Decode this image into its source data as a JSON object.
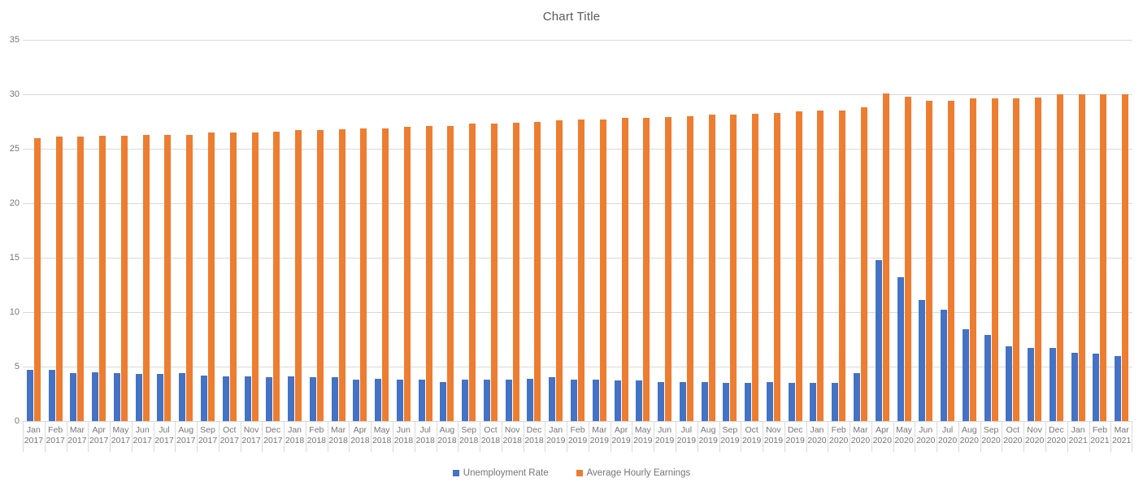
{
  "chart_data": {
    "type": "bar",
    "title": "Chart Title",
    "xlabel": "",
    "ylabel": "",
    "ylim": [
      0,
      35
    ],
    "yticks": [
      0,
      5,
      10,
      15,
      20,
      25,
      30,
      35
    ],
    "grid": true,
    "legend_position": "bottom",
    "colors": {
      "unemployment_rate": "#4472C4",
      "average_hourly_earnings": "#ED7D31"
    },
    "categories": [
      "Jan 2017",
      "Feb 2017",
      "Mar 2017",
      "Apr 2017",
      "May 2017",
      "Jun 2017",
      "Jul 2017",
      "Aug 2017",
      "Sep 2017",
      "Oct 2017",
      "Nov 2017",
      "Dec 2017",
      "Jan 2018",
      "Feb 2018",
      "Mar 2018",
      "Apr 2018",
      "May 2018",
      "Jun 2018",
      "Jul 2018",
      "Aug 2018",
      "Sep 2018",
      "Oct 2018",
      "Nov 2018",
      "Dec 2018",
      "Jan 2019",
      "Feb 2019",
      "Mar 2019",
      "Apr 2019",
      "May 2019",
      "Jun 2019",
      "Jul 2019",
      "Aug 2019",
      "Sep 2019",
      "Oct 2019",
      "Nov 2019",
      "Dec 2019",
      "Jan 2020",
      "Feb 2020",
      "Mar 2020",
      "Apr 2020",
      "May 2020",
      "Jun 2020",
      "Jul 2020",
      "Aug 2020",
      "Sep 2020",
      "Oct 2020",
      "Nov 2020",
      "Dec 2020",
      "Jan 2021",
      "Feb 2021",
      "Mar 2021"
    ],
    "category_months": [
      "Jan",
      "Feb",
      "Mar",
      "Apr",
      "May",
      "Jun",
      "Jul",
      "Aug",
      "Sep",
      "Oct",
      "Nov",
      "Dec",
      "Jan",
      "Feb",
      "Mar",
      "Apr",
      "May",
      "Jun",
      "Jul",
      "Aug",
      "Sep",
      "Oct",
      "Nov",
      "Dec",
      "Jan",
      "Feb",
      "Mar",
      "Apr",
      "May",
      "Jun",
      "Jul",
      "Aug",
      "Sep",
      "Oct",
      "Nov",
      "Dec",
      "Jan",
      "Feb",
      "Mar",
      "Apr",
      "May",
      "Jun",
      "Jul",
      "Aug",
      "Sep",
      "Oct",
      "Nov",
      "Dec",
      "Jan",
      "Feb",
      "Mar"
    ],
    "category_years": [
      "2017",
      "2017",
      "2017",
      "2017",
      "2017",
      "2017",
      "2017",
      "2017",
      "2017",
      "2017",
      "2017",
      "2017",
      "2018",
      "2018",
      "2018",
      "2018",
      "2018",
      "2018",
      "2018",
      "2018",
      "2018",
      "2018",
      "2018",
      "2018",
      "2019",
      "2019",
      "2019",
      "2019",
      "2019",
      "2019",
      "2019",
      "2019",
      "2019",
      "2019",
      "2019",
      "2019",
      "2020",
      "2020",
      "2020",
      "2020",
      "2020",
      "2020",
      "2020",
      "2020",
      "2020",
      "2020",
      "2020",
      "2020",
      "2021",
      "2021",
      "2021"
    ],
    "series": [
      {
        "name": "Unemployment Rate",
        "color": "#4472C4",
        "values": [
          4.7,
          4.7,
          4.4,
          4.5,
          4.4,
          4.3,
          4.3,
          4.4,
          4.2,
          4.1,
          4.1,
          4.0,
          4.1,
          4.0,
          4.0,
          3.8,
          3.9,
          3.8,
          3.8,
          3.6,
          3.8,
          3.8,
          3.8,
          3.9,
          4.0,
          3.8,
          3.8,
          3.7,
          3.7,
          3.6,
          3.6,
          3.6,
          3.5,
          3.5,
          3.6,
          3.5,
          3.5,
          3.5,
          4.4,
          14.8,
          13.2,
          11.1,
          10.2,
          8.4,
          7.9,
          6.9,
          6.7,
          6.7,
          6.3,
          6.2,
          6.0
        ]
      },
      {
        "name": "Average Hourly Earnings",
        "color": "#ED7D31",
        "values": [
          26.0,
          26.1,
          26.1,
          26.2,
          26.2,
          26.3,
          26.3,
          26.3,
          26.5,
          26.5,
          26.5,
          26.6,
          26.7,
          26.7,
          26.8,
          26.9,
          26.9,
          27.0,
          27.1,
          27.1,
          27.3,
          27.3,
          27.4,
          27.5,
          27.6,
          27.7,
          27.7,
          27.8,
          27.8,
          27.9,
          28.0,
          28.1,
          28.1,
          28.2,
          28.3,
          28.4,
          28.5,
          28.5,
          28.8,
          30.1,
          29.8,
          29.4,
          29.4,
          29.6,
          29.6,
          29.6,
          29.7,
          30.0,
          30.0,
          30.0,
          30.0
        ]
      }
    ]
  },
  "legend": {
    "items": [
      {
        "label": "Unemployment Rate"
      },
      {
        "label": "Average Hourly Earnings"
      }
    ]
  }
}
